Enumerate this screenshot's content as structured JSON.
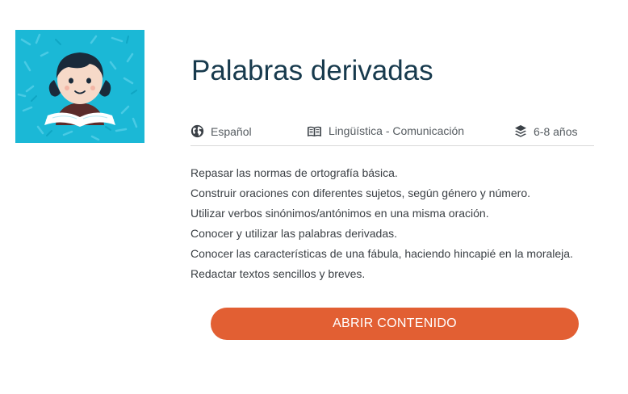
{
  "thumbnail": {
    "icon": "child-reading-book-illustration",
    "background": "#1bb8d6"
  },
  "title": "Palabras derivadas",
  "meta": {
    "language": {
      "icon": "globe-icon",
      "label": "Español"
    },
    "area": {
      "icon": "book-icon",
      "label": "Lingüística - Comunicación"
    },
    "age": {
      "icon": "layers-icon",
      "label": "6-8 años"
    }
  },
  "objectives": [
    "Repasar las normas de ortografía básica.",
    "Construir oraciones con diferentes sujetos, según género y número.",
    "Utilizar verbos sinónimos/antónimos en una misma oración.",
    "Conocer y utilizar las palabras derivadas.",
    "Conocer las características de una fábula, haciendo hincapié en la moraleja.",
    "Redactar textos sencillos y breves."
  ],
  "cta": {
    "label": "ABRIR CONTENIDO",
    "color": "#e25f33"
  },
  "colors": {
    "title": "#173a4d",
    "text": "#3a3f44",
    "meta": "#555b60"
  }
}
